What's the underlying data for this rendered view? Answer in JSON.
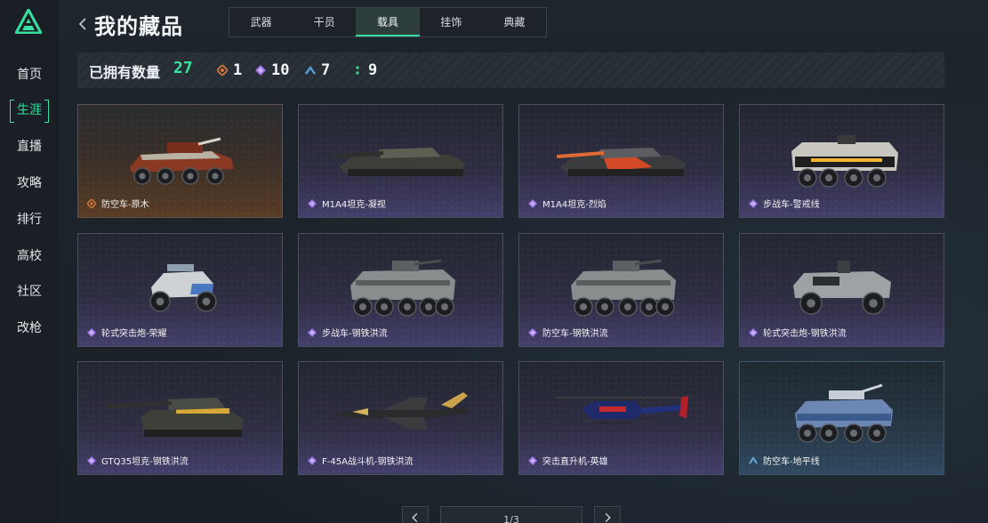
{
  "header": {
    "title": "我的藏品",
    "tabs": [
      {
        "label": "武器",
        "active": false
      },
      {
        "label": "干员",
        "active": false
      },
      {
        "label": "载具",
        "active": true
      },
      {
        "label": "挂饰",
        "active": false
      },
      {
        "label": "典藏",
        "active": false
      }
    ]
  },
  "sidebar": {
    "items": [
      {
        "label": "首页",
        "active": false
      },
      {
        "label": "生涯",
        "active": true
      },
      {
        "label": "直播",
        "active": false
      },
      {
        "label": "攻略",
        "active": false
      },
      {
        "label": "排行",
        "active": false
      },
      {
        "label": "高校",
        "active": false
      },
      {
        "label": "社区",
        "active": false
      },
      {
        "label": "改枪",
        "active": false
      }
    ]
  },
  "owned": {
    "label": "已拥有数量",
    "count": "27",
    "rarities": [
      {
        "icon": "orange-diamond-icon",
        "color": "#e07a3a",
        "count": "1"
      },
      {
        "icon": "purple-diamond-icon",
        "color": "#9a72e8",
        "count": "10"
      },
      {
        "icon": "blue-chevron-icon",
        "color": "#5a9bd8",
        "count": "7"
      },
      {
        "icon": "green-dots-icon",
        "color": "#3ecf8e",
        "count": "9"
      }
    ]
  },
  "cards": [
    {
      "name": "防空车-原木",
      "rarity": "orange",
      "vehicle": "wheeled-aa"
    },
    {
      "name": "M1A4坦克-凝视",
      "rarity": "purple",
      "vehicle": "tank"
    },
    {
      "name": "M1A4坦克-烈焰",
      "rarity": "purple",
      "vehicle": "tank-flame"
    },
    {
      "name": "步战车-警戒线",
      "rarity": "purple",
      "vehicle": "ifv-hazard"
    },
    {
      "name": "轮式突击炮-荣耀",
      "rarity": "purple",
      "vehicle": "buggy"
    },
    {
      "name": "步战车-钢铁洪流",
      "rarity": "purple",
      "vehicle": "ifv"
    },
    {
      "name": "防空车-钢铁洪流",
      "rarity": "purple",
      "vehicle": "ifv"
    },
    {
      "name": "轮式突击炮-钢铁洪流",
      "rarity": "purple",
      "vehicle": "assault-car"
    },
    {
      "name": "GTQ35坦克-钢铁洪流",
      "rarity": "purple",
      "vehicle": "tank-gtq"
    },
    {
      "name": "F-45A战斗机-钢铁洪流",
      "rarity": "purple",
      "vehicle": "jet"
    },
    {
      "name": "突击直升机-英雄",
      "rarity": "purple",
      "vehicle": "heli"
    },
    {
      "name": "防空车-地平线",
      "rarity": "blue",
      "vehicle": "wheeled-aa-blue"
    }
  ],
  "pagination": {
    "display": "1/3"
  },
  "colors": {
    "accent": "#35e0a0"
  }
}
